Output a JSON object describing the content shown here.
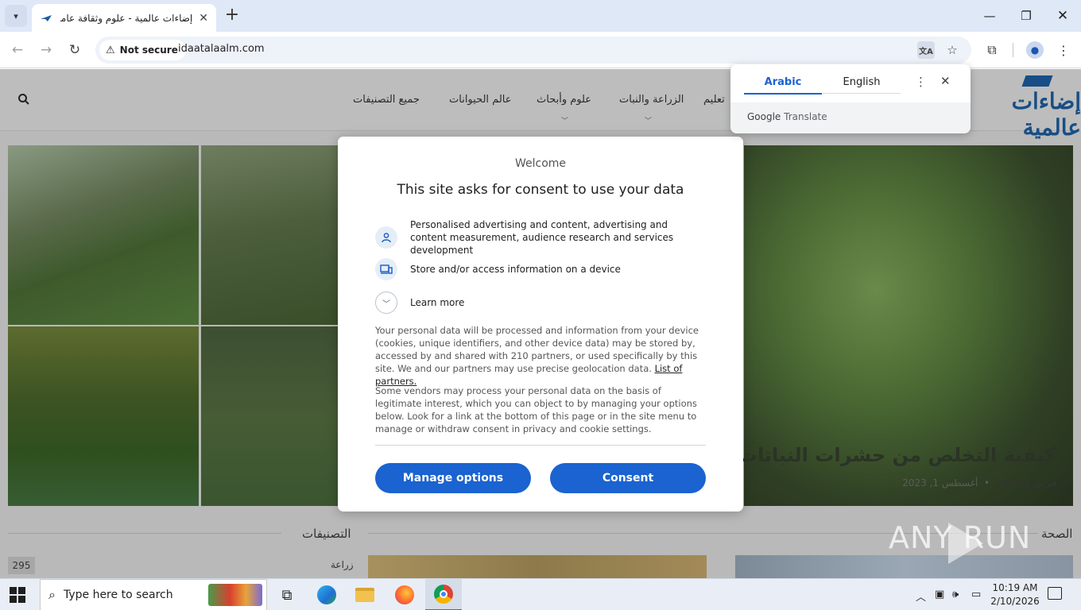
{
  "browser": {
    "tab_title": "إضاءات عالمية - علوم وثقافة عامة",
    "tab_close": "✕",
    "new_tab": "+",
    "security_label": "Not secure",
    "url": "idaatalaalm.com",
    "icons": [
      "tab-search-icon",
      "back-icon",
      "forward-icon",
      "reload-icon",
      "warning-icon",
      "translate-icon",
      "star-icon",
      "extensions-icon",
      "profile-icon",
      "menu-icon",
      "minimize-icon",
      "maximize-icon",
      "close-icon"
    ]
  },
  "site": {
    "logo": "إضاءات عالمية",
    "nav": [
      {
        "label": "جميع التصنيفات",
        "has_dropdown": false
      },
      {
        "label": "عالم الحيوانات",
        "has_dropdown": false
      },
      {
        "label": "علوم وأبحاث",
        "has_dropdown": true
      },
      {
        "label": "الزراعة والنبات",
        "has_dropdown": true
      },
      {
        "label": "تعليم",
        "has_dropdown": false
      }
    ],
    "hero_title": "كيفية التخلص من حشرات النباتات",
    "hero_author": "فريق إضاءات",
    "hero_date": "أغسطس 1, 2023",
    "categories_heading": "التصنيفات",
    "health_heading": "الصحة",
    "category_name": "زراعة",
    "category_count": "295"
  },
  "consent": {
    "welcome": "Welcome",
    "title": "This site asks for consent to use your data",
    "purpose_1": "Personalised advertising and content, advertising and content measurement, audience research and services development",
    "purpose_2": "Store and/or access information on a device",
    "learn_more": "Learn more",
    "para_1": "Your personal data will be processed and information from your device (cookies, unique identifiers, and other device data) may be stored by, accessed by and shared with 210 partners, or used specifically by this site. We and our partners may use precise geolocation data.",
    "partners_link": "List of partners.",
    "para_2": "Some vendors may process your personal data on the basis of legitimate interest, which you can object to by managing your options below. Look for a link at the bottom of this page or in the site menu to manage or withdraw consent in privacy and cookie settings.",
    "manage_button": "Manage options",
    "consent_button": "Consent",
    "accent_color": "#1a63d0"
  },
  "translate_popup": {
    "source_lang": "Arabic",
    "target_lang": "English",
    "brand_google": "Google",
    "brand_translate": "Translate"
  },
  "taskbar": {
    "search_placeholder": "Type here to search",
    "time": "10:19 AM",
    "date": "2/10/2026"
  },
  "watermark": "ANY RUN"
}
